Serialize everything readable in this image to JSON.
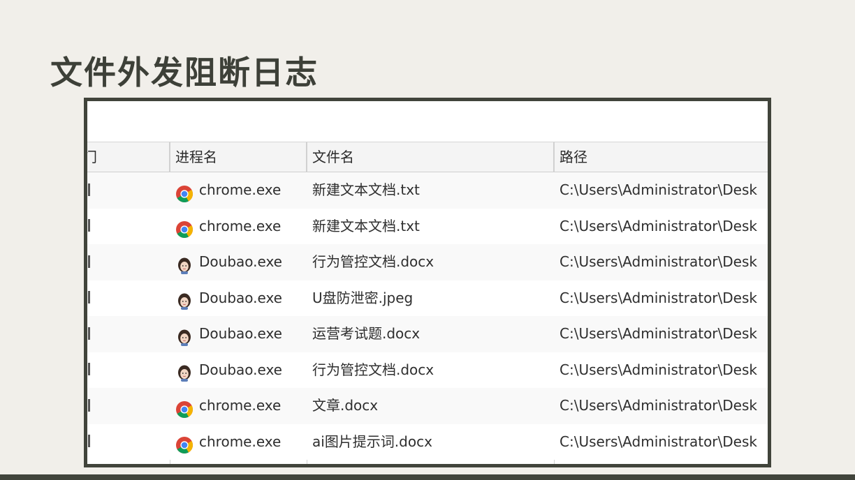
{
  "title": "文件外发阻断日志",
  "table": {
    "headers": {
      "dept": "门",
      "process": "进程名",
      "file": "文件名",
      "path": "路径"
    },
    "rows": [
      {
        "process": "chrome.exe",
        "icon": "chrome-icon",
        "file": "新建文本文档.txt",
        "path": "C:\\Users\\Administrator\\Desk"
      },
      {
        "process": "chrome.exe",
        "icon": "chrome-icon",
        "file": "新建文本文档.txt",
        "path": "C:\\Users\\Administrator\\Desk"
      },
      {
        "process": "Doubao.exe",
        "icon": "doubao-icon",
        "file": "行为管控文档.docx",
        "path": "C:\\Users\\Administrator\\Desk"
      },
      {
        "process": "Doubao.exe",
        "icon": "doubao-icon",
        "file": "U盘防泄密.jpeg",
        "path": "C:\\Users\\Administrator\\Desk"
      },
      {
        "process": "Doubao.exe",
        "icon": "doubao-icon",
        "file": "运营考试题.docx",
        "path": "C:\\Users\\Administrator\\Desk"
      },
      {
        "process": "Doubao.exe",
        "icon": "doubao-icon",
        "file": "行为管控文档.docx",
        "path": "C:\\Users\\Administrator\\Desk"
      },
      {
        "process": "chrome.exe",
        "icon": "chrome-icon",
        "file": "文章.docx",
        "path": "C:\\Users\\Administrator\\Desk"
      },
      {
        "process": "chrome.exe",
        "icon": "chrome-icon",
        "file": "ai图片提示词.docx",
        "path": "C:\\Users\\Administrator\\Desk"
      }
    ]
  },
  "colors": {
    "background": "#f1efea",
    "frame": "#41443b",
    "title": "#3d4038"
  }
}
